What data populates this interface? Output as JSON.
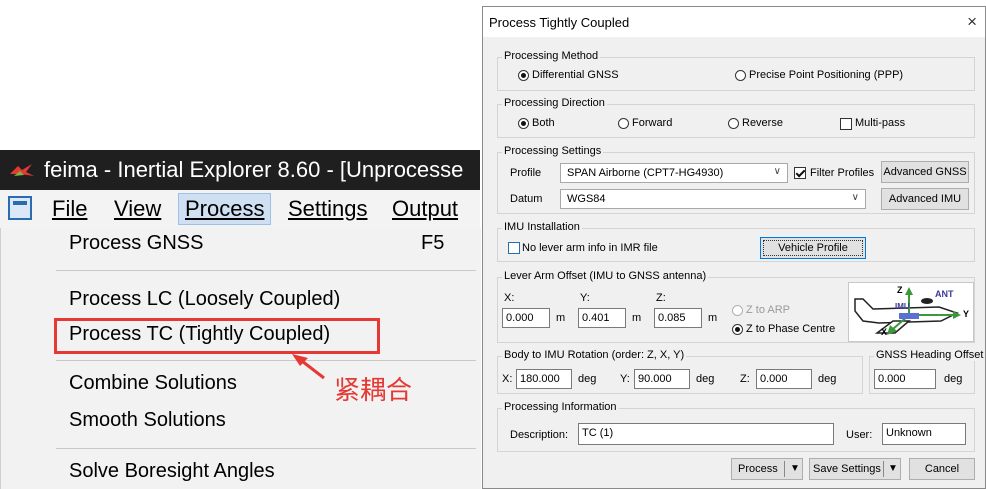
{
  "left": {
    "window_title": "feima - Inertial Explorer 8.60 - [Unprocesse",
    "menubar": [
      "File",
      "View",
      "Process",
      "Settings",
      "Output"
    ],
    "menu": {
      "process_gnss": "Process GNSS",
      "process_gnss_shortcut": "F5",
      "process_lc": "Process LC (Loosely Coupled)",
      "process_tc": "Process TC (Tightly Coupled)",
      "combine": "Combine Solutions",
      "smooth": "Smooth Solutions",
      "boresight": "Solve Boresight Angles"
    },
    "annotation": "紧耦合",
    "highlight_color": "#e53935"
  },
  "dialog": {
    "title": "Process Tightly Coupled",
    "close": "×",
    "processing_method": {
      "label": "Processing Method",
      "options": [
        "Differential GNSS",
        "Precise Point Positioning (PPP)"
      ],
      "selected": "Differential GNSS"
    },
    "processing_direction": {
      "label": "Processing Direction",
      "options": [
        "Both",
        "Forward",
        "Reverse"
      ],
      "selected": "Both",
      "multipass_label": "Multi-pass",
      "multipass_checked": false
    },
    "processing_settings": {
      "label": "Processing Settings",
      "profile_label": "Profile",
      "profile_value": "SPAN Airborne (CPT7-HG4930)",
      "filter_profiles_label": "Filter Profiles",
      "filter_profiles_checked": true,
      "advanced_gnss": "Advanced GNSS",
      "datum_label": "Datum",
      "datum_value": "WGS84",
      "advanced_imu": "Advanced IMU"
    },
    "imu_installation": {
      "label": "IMU Installation",
      "no_lever_arm_label": "No lever arm info in IMR file",
      "no_lever_arm_checked": false,
      "vehicle_profile": "Vehicle Profile"
    },
    "lever_arm": {
      "label": "Lever Arm Offset (IMU to GNSS antenna)",
      "x_label": "X:",
      "x_value": "0.000",
      "y_label": "Y:",
      "y_value": "0.401",
      "z_label": "Z:",
      "z_value": "0.085",
      "unit": "m",
      "z_to_arp": "Z to ARP",
      "z_to_phase": "Z to Phase Centre",
      "selected": "Z to Phase Centre",
      "diagram_labels": {
        "z": "Z",
        "ant": "ANT",
        "imu": "IMU",
        "x": "X",
        "y": "Y"
      }
    },
    "body_rotation": {
      "label": "Body to IMU Rotation (order: Z, X, Y)",
      "x_label": "X:",
      "x_value": "180.000",
      "y_label": "Y:",
      "y_value": "90.000",
      "z_label": "Z:",
      "z_value": "0.000",
      "unit": "deg"
    },
    "gnss_heading": {
      "label": "GNSS Heading Offset",
      "value": "0.000",
      "unit": "deg"
    },
    "processing_info": {
      "label": "Processing Information",
      "description_label": "Description:",
      "description_value": "TC (1)",
      "user_label": "User:",
      "user_value": "Unknown"
    },
    "buttons": {
      "process": "Process",
      "save_settings": "Save Settings",
      "cancel": "Cancel"
    }
  }
}
